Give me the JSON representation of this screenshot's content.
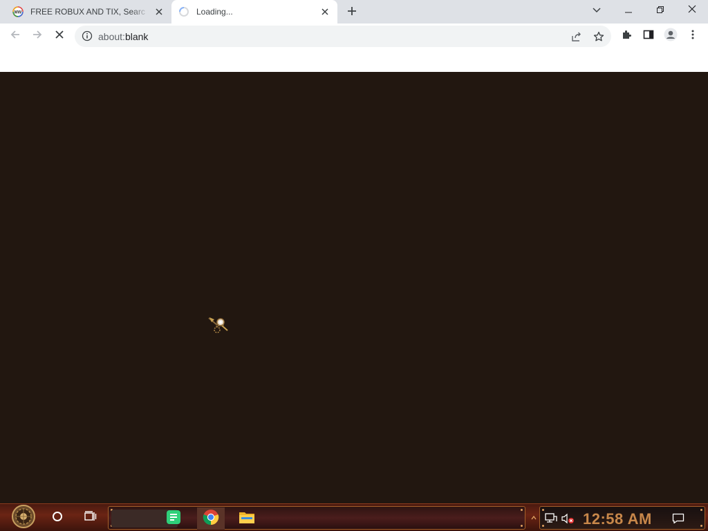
{
  "browser": {
    "tabs": [
      {
        "label": "FREE ROBUX AND TIX, Searc",
        "favicon": "mw-favicon-icon",
        "active": false
      },
      {
        "label": "Loading...",
        "favicon": "loading-spinner-icon",
        "active": true
      }
    ],
    "new_tab_icon": "plus-icon",
    "window_controls": [
      "tab-search-icon",
      "minimize-icon",
      "restore-icon",
      "close-icon"
    ]
  },
  "toolbar": {
    "url_scheme": "about:",
    "url_path": "blank",
    "icons": [
      "back-icon",
      "forward-icon",
      "stop-icon",
      "info-icon",
      "share-icon",
      "star-icon",
      "extensions-icon",
      "side-panel-icon",
      "profile-icon",
      "menu-icon"
    ]
  },
  "page": {
    "background": "#221710",
    "cursor_icon": "steampunk-cursor-icon"
  },
  "taskbar": {
    "apps": [
      "start-gear-icon",
      "cortana-icon",
      "task-view-icon",
      "chat-app-icon",
      "chrome-icon",
      "file-explorer-icon"
    ],
    "tray_icons": [
      "show-hidden-icons",
      "network-icon",
      "volume-muted-icon",
      "notification-icon"
    ],
    "clock": "12:58 AM",
    "accent": "#c8874a"
  }
}
